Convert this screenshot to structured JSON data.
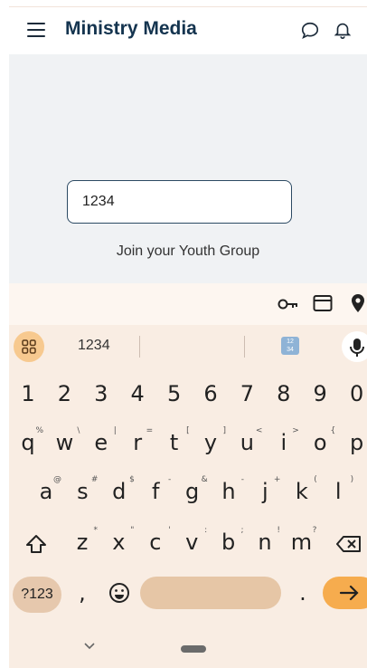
{
  "app": {
    "title": "Ministry Media",
    "icons": [
      "menu-icon",
      "chat-bubble-icon",
      "bell-icon"
    ]
  },
  "main": {
    "code_input": {
      "value": "1234"
    },
    "join_label": "Join your Youth Group"
  },
  "keyboard": {
    "toolbar_icons": [
      "key-icon",
      "card-icon",
      "location-pin-icon"
    ],
    "suggestions": [
      "1234"
    ],
    "row_numbers": [
      "1",
      "2",
      "3",
      "4",
      "5",
      "6",
      "7",
      "8",
      "9",
      "0"
    ],
    "row1": [
      {
        "k": "q",
        "s": "%"
      },
      {
        "k": "w",
        "s": "\\"
      },
      {
        "k": "e",
        "s": "|"
      },
      {
        "k": "r",
        "s": "="
      },
      {
        "k": "t",
        "s": "["
      },
      {
        "k": "y",
        "s": "]"
      },
      {
        "k": "u",
        "s": "<"
      },
      {
        "k": "i",
        "s": ">"
      },
      {
        "k": "o",
        "s": "{"
      },
      {
        "k": "p",
        "s": "}"
      }
    ],
    "row2": [
      {
        "k": "a",
        "s": "@"
      },
      {
        "k": "s",
        "s": "#"
      },
      {
        "k": "d",
        "s": "$"
      },
      {
        "k": "f",
        "s": "-"
      },
      {
        "k": "g",
        "s": "&"
      },
      {
        "k": "h",
        "s": "-"
      },
      {
        "k": "j",
        "s": "+"
      },
      {
        "k": "k",
        "s": "("
      },
      {
        "k": "l",
        "s": ")"
      }
    ],
    "row3": [
      {
        "k": "z",
        "s": "*"
      },
      {
        "k": "x",
        "s": "\""
      },
      {
        "k": "c",
        "s": "'"
      },
      {
        "k": "v",
        "s": ":"
      },
      {
        "k": "b",
        "s": ";"
      },
      {
        "k": "n",
        "s": "!"
      },
      {
        "k": "m",
        "s": "?"
      }
    ],
    "bottom": {
      "numbers_label": "?123",
      "comma": ",",
      "period": "."
    },
    "colors": {
      "background": "#f9ede3",
      "accent": "#f6ac4e",
      "space": "#e6c6a6"
    }
  }
}
